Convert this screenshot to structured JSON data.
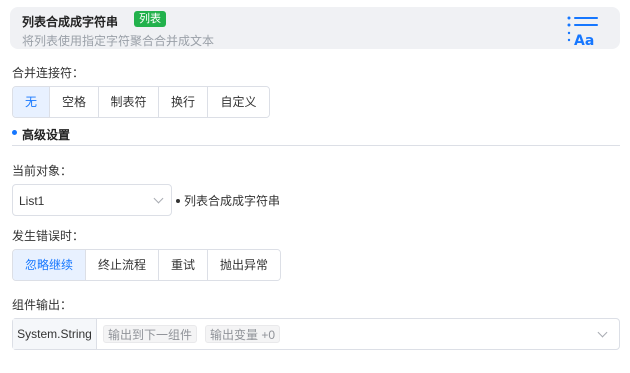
{
  "header": {
    "title": "列表合成成字符串",
    "badge": "列表",
    "description": "将列表使用指定字符聚合合并成文本",
    "icon": "list-to-text-icon",
    "accent": "#1677ff",
    "badge_color": "#22b14c"
  },
  "joiner": {
    "label": "合并连接符：",
    "options": [
      "无",
      "空格",
      "制表符",
      "换行",
      "自定义"
    ],
    "selected": "无"
  },
  "advanced": {
    "title": "高级设置"
  },
  "current_object": {
    "label": "当前对象：",
    "value": "List1",
    "note": "列表合成成字符串"
  },
  "on_error": {
    "label": "发生错误时：",
    "options": [
      "忽略继续",
      "终止流程",
      "重试",
      "抛出异常"
    ],
    "selected": "忽略继续"
  },
  "output": {
    "label": "组件输出：",
    "type": "System.String",
    "tag_next": "输出到下一组件",
    "tag_var": "输出变量 +0"
  }
}
